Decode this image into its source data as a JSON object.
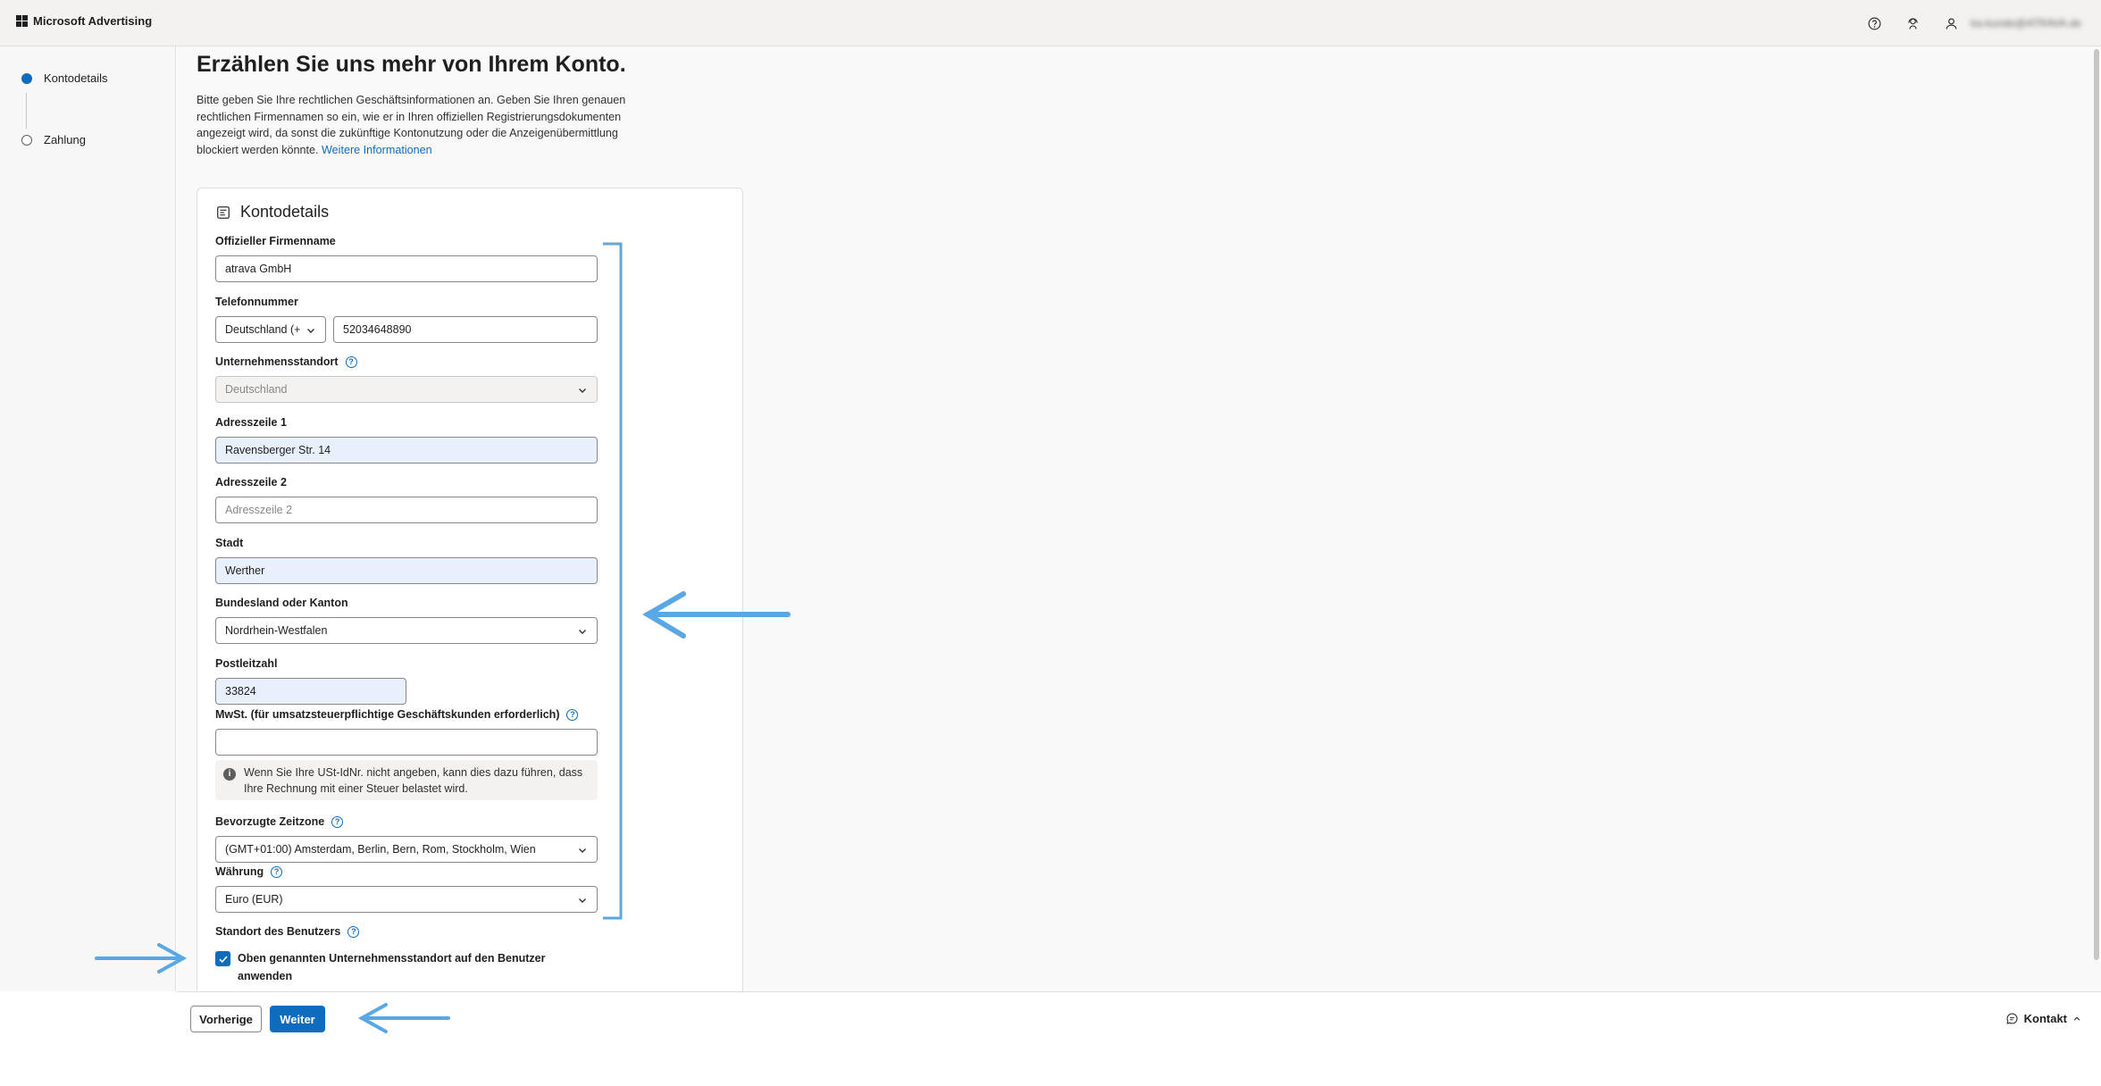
{
  "topbar": {
    "brand": "Microsoft Advertising",
    "icons": [
      "help-icon",
      "support-agent-icon",
      "user-icon"
    ],
    "user_email": "ka-kunde@ATRAVA.de"
  },
  "sidebar": {
    "steps": [
      {
        "label": "Kontodetails",
        "state": "active"
      },
      {
        "label": "Zahlung",
        "state": "inactive"
      }
    ]
  },
  "main": {
    "title": "Erzählen Sie uns mehr von Ihrem Konto.",
    "intro_text": "Bitte geben Sie Ihre rechtlichen Geschäftsinformationen an. Geben Sie Ihren genauen rechtlichen Firmennamen so ein, wie er in Ihren offiziellen Registrierungsdokumenten angezeigt wird, da sonst die zukünftige Kontonutzung oder die Anzeigenübermittlung blockiert werden könnte.",
    "intro_link": "Weitere Informationen"
  },
  "card": {
    "title": "Kontodetails",
    "fields": {
      "company_name": {
        "label": "Offizieller Firmenname",
        "value": "atrava GmbH"
      },
      "phone": {
        "label": "Telefonnummer",
        "country": "Deutschland (+",
        "value": "52034648890"
      },
      "business_location": {
        "label": "Unternehmensstandort",
        "value": "Deutschland"
      },
      "address1": {
        "label": "Adresszeile 1",
        "value": "Ravensberger Str. 14"
      },
      "address2": {
        "label": "Adresszeile 2",
        "placeholder": "Adresszeile 2"
      },
      "city": {
        "label": "Stadt",
        "value": "Werther"
      },
      "state": {
        "label": "Bundesland oder Kanton",
        "value": "Nordrhein-Westfalen"
      },
      "postal": {
        "label": "Postleitzahl",
        "value": "33824"
      },
      "vat": {
        "label": "MwSt. (für umsatzsteuerpflichtige Geschäftskunden erforderlich)",
        "value": ""
      },
      "timezone": {
        "label": "Bevorzugte Zeitzone",
        "value": "(GMT+01:00) Amsterdam, Berlin, Bern, Rom, Stockholm, Wien"
      },
      "currency": {
        "label": "Währung",
        "value": "Euro (EUR)"
      },
      "user_location": {
        "label": "Standort des Benutzers",
        "checkbox_label": "Oben genannten Unternehmensstandort auf den Benutzer anwenden",
        "checked": true
      }
    },
    "vat_notice": "Wenn Sie Ihre USt-IdNr. nicht angeben, kann dies dazu führen, dass Ihre Rechnung mit einer Steuer belastet wird."
  },
  "footer": {
    "back_label": "Vorherige",
    "next_label": "Weiter",
    "contact_label": "Kontakt"
  },
  "colors": {
    "accent": "#0f6cbd",
    "annotation": "#5aa7e6",
    "autofill": "#e8f0fe"
  }
}
